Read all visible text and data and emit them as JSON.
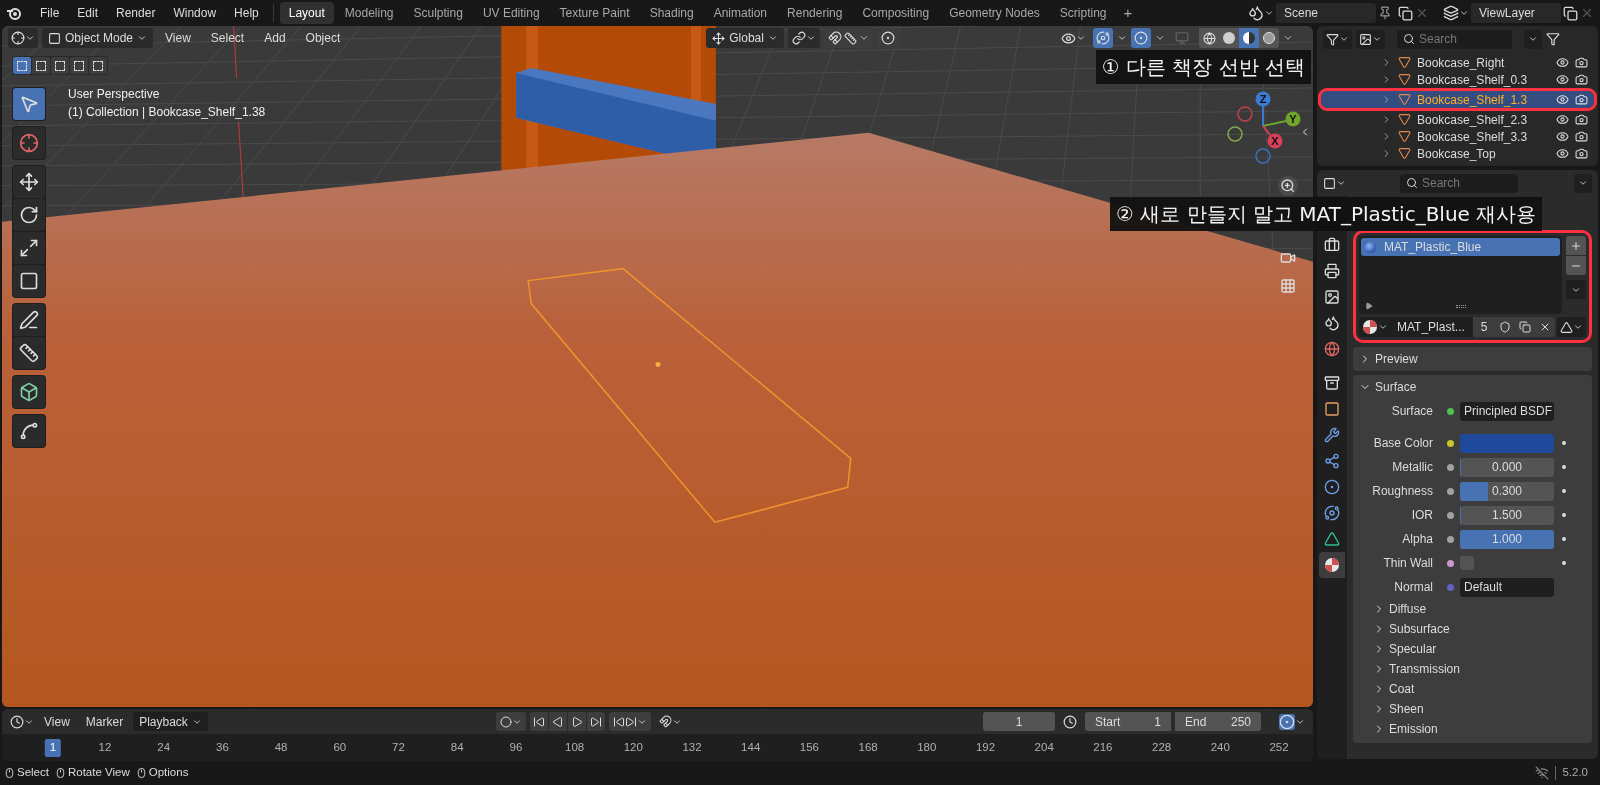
{
  "top_bar": {
    "menus": [
      "File",
      "Edit",
      "Render",
      "Window",
      "Help"
    ],
    "workspaces": [
      {
        "label": "Layout",
        "selected": true
      },
      {
        "label": "Modeling",
        "selected": false
      },
      {
        "label": "Sculpting",
        "selected": false
      },
      {
        "label": "UV Editing",
        "selected": false
      },
      {
        "label": "Texture Paint",
        "selected": false
      },
      {
        "label": "Shading",
        "selected": false
      },
      {
        "label": "Animation",
        "selected": false
      },
      {
        "label": "Rendering",
        "selected": false
      },
      {
        "label": "Compositing",
        "selected": false
      },
      {
        "label": "Geometry Nodes",
        "selected": false
      },
      {
        "label": "Scripting",
        "selected": false
      }
    ],
    "add_workspace": "+",
    "scene": "Scene",
    "view_layer": "ViewLayer"
  },
  "viewport": {
    "mode": "Object Mode",
    "menus": [
      "View",
      "Select",
      "Add",
      "Object"
    ],
    "orientation": "Global",
    "select_modes": [
      {
        "selected": true
      },
      {
        "selected": false
      },
      {
        "selected": false
      },
      {
        "selected": false
      },
      {
        "selected": false
      }
    ],
    "shading_modes": [
      {
        "kind": "wireframe",
        "selected": false
      },
      {
        "kind": "solid",
        "selected": false
      },
      {
        "kind": "material",
        "selected": true
      },
      {
        "kind": "rendered",
        "selected": false
      }
    ],
    "view_name": "User Perspective",
    "info": "(1) Collection | Bookcase_Shelf_1.38",
    "tools": [
      {
        "kind": "select",
        "selected": true
      },
      {
        "kind": "cursor",
        "selected": false
      },
      {
        "kind": "move",
        "selected": false
      },
      {
        "kind": "rotate",
        "selected": false
      },
      {
        "kind": "scale",
        "selected": false
      },
      {
        "kind": "transform",
        "selected": false
      },
      {
        "kind": "annotate",
        "selected": false
      },
      {
        "kind": "measure",
        "selected": false
      },
      {
        "kind": "add-cube",
        "selected": false
      },
      {
        "kind": "curve",
        "selected": false
      }
    ],
    "axes": [
      {
        "label": "Z"
      },
      {
        "label": "Y"
      },
      {
        "label": "X"
      }
    ]
  },
  "annotations": [
    {
      "text": "① 다른 책장 선반 선택"
    },
    {
      "text": "② 새로 만들지 말고 MAT_Plastic_Blue 재사용"
    }
  ],
  "outliner": {
    "search_placeholder": "Search",
    "rows": [
      {
        "name": "Bookcase_Right",
        "selected": false
      },
      {
        "name": "Bookcase_Shelf_0.3",
        "selected": false
      },
      {
        "name": "Bookcase_Shelf_1.3",
        "selected": true
      },
      {
        "name": "Bookcase_Shelf_2.3",
        "selected": false
      },
      {
        "name": "Bookcase_Shelf_3.3",
        "selected": false
      },
      {
        "name": "Bookcase_Top",
        "selected": false
      }
    ]
  },
  "properties": {
    "search_placeholder": "Search",
    "tabs": [
      {
        "kind": "tool",
        "selected": false
      },
      {
        "kind": "render",
        "selected": false
      },
      {
        "kind": "output",
        "selected": false
      },
      {
        "kind": "view-layer",
        "selected": false
      },
      {
        "kind": "world",
        "selected": false
      },
      {
        "kind": "collection",
        "selected": false
      },
      {
        "kind": "object",
        "selected": false
      },
      {
        "kind": "modifiers",
        "selected": false
      },
      {
        "kind": "particles",
        "selected": false
      },
      {
        "kind": "physics",
        "selected": false
      },
      {
        "kind": "constraints",
        "selected": false
      },
      {
        "kind": "data",
        "selected": false
      },
      {
        "kind": "material",
        "selected": true
      }
    ],
    "material_slots": [
      {
        "name": "MAT_Plastic_Blue",
        "selected": true
      }
    ],
    "material_name": "MAT_Plast...",
    "users": "5",
    "panels": [
      {
        "title": "Preview",
        "expanded": false
      },
      {
        "title": "Surface",
        "expanded": true
      }
    ],
    "surface_rows": [
      {
        "label": "Surface",
        "kind": "link",
        "socket": {
          "color": "#4fc04f"
        },
        "value": "Principled BSDF"
      },
      {
        "label": "Base Color",
        "kind": "color",
        "socket": {
          "color": "#c7c729"
        },
        "color": "#1f4a9c"
      },
      {
        "label": "Metallic",
        "kind": "slider",
        "socket": {
          "color": "#a1a1a1"
        },
        "value": "0.000",
        "level": 0
      },
      {
        "label": "Roughness",
        "kind": "slider",
        "socket": {
          "color": "#a1a1a1"
        },
        "value": "0.300",
        "level": 0.3
      },
      {
        "label": "IOR",
        "kind": "slider",
        "socket": {
          "color": "#a1a1a1"
        },
        "value": "1.500",
        "level": 0
      },
      {
        "label": "Alpha",
        "kind": "slider",
        "socket": {
          "color": "#a1a1a1"
        },
        "value": "1.000",
        "level": 1
      },
      {
        "label": "Thin Wall",
        "kind": "checkbox",
        "socket": {
          "color": "#cc99cc"
        },
        "checked": false
      },
      {
        "label": "Normal",
        "kind": "link",
        "socket": {
          "color": "#6363c7"
        },
        "value": "Default"
      }
    ],
    "subpanels": [
      {
        "title": "Diffuse",
        "expanded": false
      },
      {
        "title": "Subsurface",
        "expanded": false
      },
      {
        "title": "Specular",
        "expanded": false
      },
      {
        "title": "Transmission",
        "expanded": false
      },
      {
        "title": "Coat",
        "expanded": false
      },
      {
        "title": "Sheen",
        "expanded": false
      },
      {
        "title": "Emission",
        "expanded": false
      }
    ]
  },
  "timeline": {
    "menus": [
      "View",
      "Marker"
    ],
    "playback": "Playback",
    "current_frame": "1",
    "start_label": "Start",
    "start": "1",
    "end_label": "End",
    "end": "250",
    "ruler": [
      {
        "label": "1",
        "selected": true
      },
      {
        "label": "12",
        "selected": false
      },
      {
        "label": "24",
        "selected": false
      },
      {
        "label": "36",
        "selected": false
      },
      {
        "label": "48",
        "selected": false
      },
      {
        "label": "60",
        "selected": false
      },
      {
        "label": "72",
        "selected": false
      },
      {
        "label": "84",
        "selected": false
      },
      {
        "label": "96",
        "selected": false
      },
      {
        "label": "108",
        "selected": false
      },
      {
        "label": "120",
        "selected": false
      },
      {
        "label": "132",
        "selected": false
      },
      {
        "label": "144",
        "selected": false
      },
      {
        "label": "156",
        "selected": false
      },
      {
        "label": "168",
        "selected": false
      },
      {
        "label": "180",
        "selected": false
      },
      {
        "label": "192",
        "selected": false
      },
      {
        "label": "204",
        "selected": false
      },
      {
        "label": "216",
        "selected": false
      },
      {
        "label": "228",
        "selected": false
      },
      {
        "label": "240",
        "selected": false
      },
      {
        "label": "252",
        "selected": false
      }
    ]
  },
  "status_bar": {
    "hints": [
      {
        "label": "Select"
      },
      {
        "label": "Rotate View"
      },
      {
        "label": "Options"
      }
    ],
    "version": "5.2.0"
  }
}
